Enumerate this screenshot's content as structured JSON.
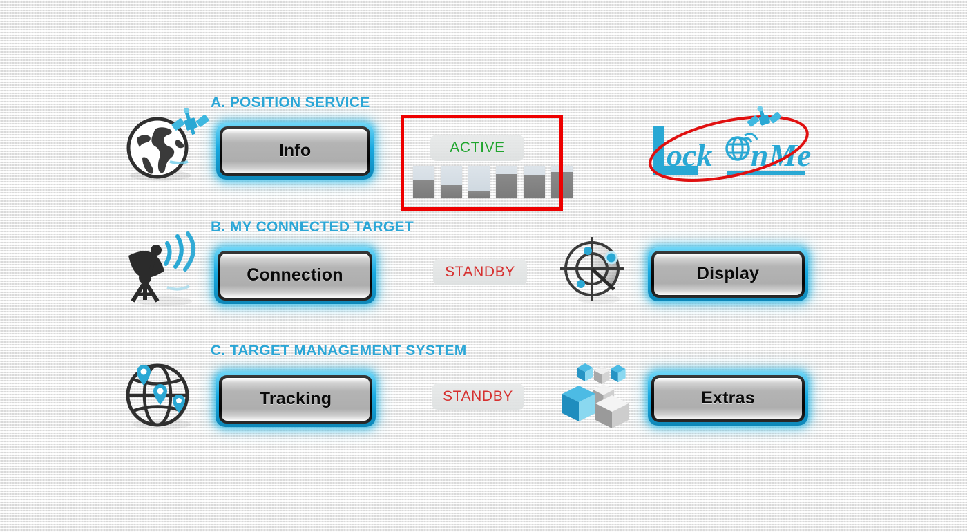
{
  "app": {
    "logo_text": "Lock On Me",
    "background_color": "#f2f2f2",
    "accent_color": "#2ba6d6",
    "active_color": "#20a52e",
    "standby_color": "#d6302f",
    "highlight_color": "#ee0000"
  },
  "sections": [
    {
      "id": "position-service",
      "heading": "A. POSITION SERVICE",
      "icon": "globe-satellite-icon",
      "primary_button": "Info",
      "status": "ACTIVE",
      "status_state": "active",
      "secondary_icon": null,
      "secondary_button": null,
      "highlighted": true
    },
    {
      "id": "my-connected-target",
      "heading": "B. MY CONNECTED TARGET",
      "icon": "satellite-dish-icon",
      "primary_button": "Connection",
      "status": "STANDBY",
      "status_state": "standby",
      "secondary_icon": "radar-target-icon",
      "secondary_button": "Display",
      "highlighted": false
    },
    {
      "id": "target-management-system",
      "heading": "C. TARGET MANAGEMENT SYSTEM",
      "icon": "globe-pins-icon",
      "primary_button": "Tracking",
      "status": "STANDBY",
      "status_state": "standby",
      "secondary_icon": "cubes-icon",
      "secondary_button": "Extras",
      "highlighted": false
    }
  ],
  "signal_meter": {
    "name": "signal-strength-meter",
    "bar_count": 6,
    "levels_percent": [
      55,
      40,
      20,
      75,
      70,
      80
    ]
  }
}
